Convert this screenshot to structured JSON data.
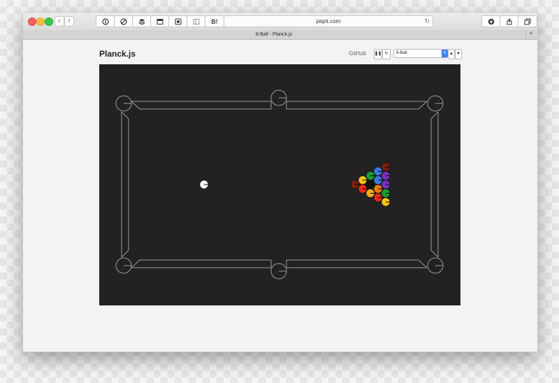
{
  "browser": {
    "url": "piqnt.com",
    "tab_title": "8-Ball - Planck.js",
    "back_glyph": "‹",
    "forward_glyph": "›",
    "bookmark_label": "B!",
    "reload_glyph": "↻",
    "new_tab_glyph": "+",
    "toolbar_icons": [
      "back-icon",
      "forward-icon",
      "1password-icon",
      "block-icon",
      "layers-icon",
      "reader-icon",
      "screenshot-icon",
      "sidebar-icon",
      "bookmark-icon",
      "download-icon",
      "share-icon",
      "tabs-icon"
    ]
  },
  "page": {
    "title": "Planck.js",
    "github_label": "GitHub",
    "pause_glyph": "❚❚",
    "restart_glyph": "↻",
    "example_select_value": "8-Ball",
    "select_arrow_glyph": "⇕",
    "prev_glyph": "▲",
    "next_glyph": "▼"
  },
  "game": {
    "table_color": "#222222",
    "rail_color": "#9a9a9a",
    "cue_ball_color": "#ffffff",
    "ball_colors": [
      "#f2c614",
      "#e8291c",
      "#f4aa1d",
      "#3b7be0",
      "#7c2fbf",
      "#f07a12",
      "#1a9e2e",
      "#7a1f0e",
      "#141414"
    ]
  }
}
